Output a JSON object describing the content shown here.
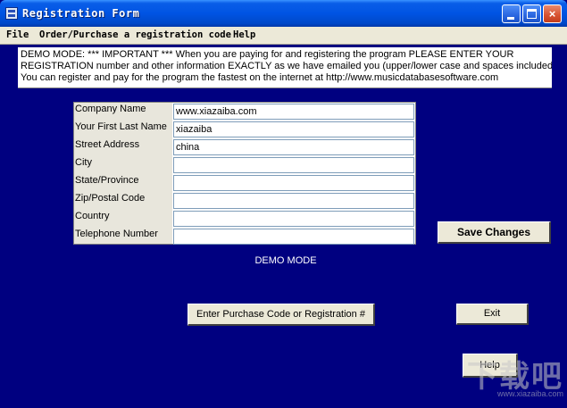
{
  "window": {
    "title": "Registration Form",
    "controls": {
      "minimize": "minimize",
      "maximize": "maximize",
      "close": "×"
    }
  },
  "menu": [
    {
      "label": "File"
    },
    {
      "label": "Order/Purchase a registration code"
    },
    {
      "label": "Help"
    }
  ],
  "notice": {
    "lines": [
      "DEMO MODE:  *** IMPORTANT *** When you are paying for and registering the program PLEASE ENTER YOUR",
      "REGISTRATION number and other information EXACTLY as we have emailed you (upper/lower case and spaces included)",
      "You can register and pay for the program the fastest on the internet at http://www.musicdatabasesoftware.com"
    ]
  },
  "form": {
    "fields": [
      {
        "label": "Company Name",
        "value": "www.xiazaiba.com"
      },
      {
        "label": "Your First Last Name",
        "value": "xiazaiba"
      },
      {
        "label": "Street Address",
        "value": "china"
      },
      {
        "label": "City",
        "value": ""
      },
      {
        "label": "State/Province",
        "value": ""
      },
      {
        "label": "Zip/Postal Code",
        "value": ""
      },
      {
        "label": "Country",
        "value": ""
      },
      {
        "label": "Telephone Number",
        "value": ""
      }
    ]
  },
  "status": "DEMO MODE",
  "buttons": {
    "save": "Save Changes",
    "enter_code": "Enter Purchase Code or Registration #",
    "exit": "Exit",
    "help": "Help"
  },
  "watermark": {
    "main": "下载吧",
    "url": "www.xiazaiba.com"
  },
  "colors": {
    "background": "#000080",
    "titlebar": "#0054e3",
    "button_face": "#ece9d8"
  }
}
